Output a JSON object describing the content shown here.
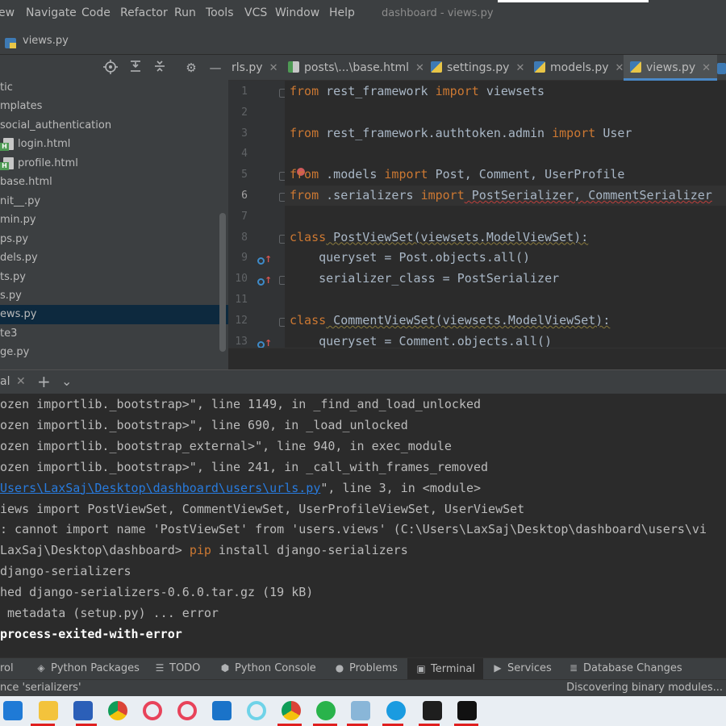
{
  "menubar": {
    "items": [
      "ew",
      "Navigate",
      "Code",
      "Refactor",
      "Run",
      "Tools",
      "VCS",
      "Window",
      "Help"
    ],
    "window_title": "dashboard - views.py"
  },
  "breadcrumb": {
    "file": "views.py"
  },
  "project": {
    "tree": [
      {
        "label": "tic",
        "type": "folder"
      },
      {
        "label": "mplates",
        "type": "folder"
      },
      {
        "label": "social_authentication",
        "type": "folder"
      },
      {
        "label": "login.html",
        "type": "html"
      },
      {
        "label": "profile.html",
        "type": "html"
      },
      {
        "label": "base.html",
        "type": "file"
      },
      {
        "label": "nit__.py",
        "type": "file"
      },
      {
        "label": "min.py",
        "type": "file"
      },
      {
        "label": "ps.py",
        "type": "file"
      },
      {
        "label": "dels.py",
        "type": "file"
      },
      {
        "label": "ts.py",
        "type": "file"
      },
      {
        "label": "s.py",
        "type": "file"
      },
      {
        "label": "ews.py",
        "type": "file",
        "selected": true
      },
      {
        "label": "te3",
        "type": "file"
      },
      {
        "label": "ge.py",
        "type": "file"
      }
    ]
  },
  "tabs": [
    {
      "label": "rls.py",
      "icon": "none"
    },
    {
      "label": "posts\\...\\base.html",
      "icon": "html-file-icon"
    },
    {
      "label": "settings.py",
      "icon": "python-file-icon"
    },
    {
      "label": "models.py",
      "icon": "python-file-icon"
    },
    {
      "label": "views.py",
      "icon": "python-file-icon",
      "active": true
    }
  ],
  "editor": {
    "current_line": 6,
    "line_numbers": [
      "1",
      "2",
      "3",
      "4",
      "5",
      "6",
      "7",
      "8",
      "9",
      "10",
      "11",
      "12",
      "13"
    ],
    "lines": [
      [
        [
          "kw",
          "from"
        ],
        [
          "t",
          " rest_framework "
        ],
        [
          "kw",
          "import"
        ],
        [
          "t",
          " viewsets"
        ]
      ],
      [],
      [
        [
          "kw",
          "from"
        ],
        [
          "t",
          " rest_framework.authtoken.admin "
        ],
        [
          "kw",
          "import"
        ],
        [
          "t",
          " User"
        ]
      ],
      [],
      [
        [
          "kw",
          "from"
        ],
        [
          "t",
          " .models "
        ],
        [
          "kw",
          "import"
        ],
        [
          "t",
          " Post, Comment, UserProfile"
        ]
      ],
      [
        [
          "kw",
          "from"
        ],
        [
          "t",
          " .serializers "
        ],
        [
          "kw",
          "import"
        ],
        [
          "sq",
          " PostSerializer, CommentSerializer"
        ]
      ],
      [],
      [
        [
          "kw",
          "class"
        ],
        [
          "sy",
          " PostViewSet(viewsets.ModelViewSet):"
        ]
      ],
      [
        [
          "t",
          "    queryset = Post.objects.all()"
        ]
      ],
      [
        [
          "t",
          "    serializer_class = PostSerializer"
        ]
      ],
      [],
      [
        [
          "kw",
          "class"
        ],
        [
          "sy",
          " CommentViewSet(viewsets.ModelViewSet):"
        ]
      ],
      [
        [
          "t",
          "    queryset = Comment.objects.all()"
        ]
      ]
    ]
  },
  "terminal": {
    "tab_label": "al",
    "lines": [
      [
        [
          "t",
          "ozen importlib._bootstrap>\", line 1149, in _find_and_load_unlocked"
        ]
      ],
      [
        [
          "t",
          "ozen importlib._bootstrap>\", line 690, in _load_unlocked"
        ]
      ],
      [
        [
          "t",
          "ozen importlib._bootstrap_external>\", line 940, in exec_module"
        ]
      ],
      [
        [
          "t",
          "ozen importlib._bootstrap>\", line 241, in _call_with_frames_removed"
        ]
      ],
      [
        [
          "link",
          "Users\\LaxSaj\\Desktop\\dashboard\\users\\urls.py"
        ],
        [
          "t",
          "\", line 3, in <module>"
        ]
      ],
      [
        [
          "t",
          "iews import PostViewSet, CommentViewSet, UserProfileViewSet, UserViewSet"
        ]
      ],
      [
        [
          "t",
          ": cannot import name 'PostViewSet' from 'users.views' (C:\\Users\\LaxSaj\\Desktop\\dashboard\\users\\vi"
        ]
      ],
      [
        [
          "t",
          "LaxSaj\\Desktop\\dashboard> "
        ],
        [
          "cmd",
          "pip"
        ],
        [
          "t",
          " install django-serializers"
        ]
      ],
      [
        [
          "t",
          "django-serializers"
        ]
      ],
      [
        [
          "t",
          "hed django-serializers-0.6.0.tar.gz (19 kB)"
        ]
      ],
      [
        [
          "t",
          " metadata (setup.py) ... error"
        ]
      ],
      [
        [
          "bold",
          "process-exited-with-error"
        ]
      ]
    ]
  },
  "toolwindows": [
    {
      "label": "rol",
      "icon": ""
    },
    {
      "label": "Python Packages",
      "icon": "layers-icon"
    },
    {
      "label": "TODO",
      "icon": "list-icon"
    },
    {
      "label": "Python Console",
      "icon": "python-icon"
    },
    {
      "label": "Problems",
      "icon": "info-icon"
    },
    {
      "label": "Terminal",
      "icon": "terminal-icon",
      "active": true
    },
    {
      "label": "Services",
      "icon": "play-icon"
    },
    {
      "label": "Database Changes",
      "icon": "database-icon"
    }
  ],
  "statusbar": {
    "left": "nce 'serializers'",
    "right": "Discovering binary modules..."
  },
  "taskbar": {
    "apps": [
      "edge-icon",
      "file-explorer-icon",
      "store-icon",
      "chrome-icon",
      "opera-icon",
      "opera-gx-icon",
      "mail-icon",
      "cortana-icon",
      "chrome-icon",
      "whatsapp-icon",
      "notepad-icon",
      "skype-icon",
      "cmd-icon",
      "pycharm-icon"
    ]
  }
}
